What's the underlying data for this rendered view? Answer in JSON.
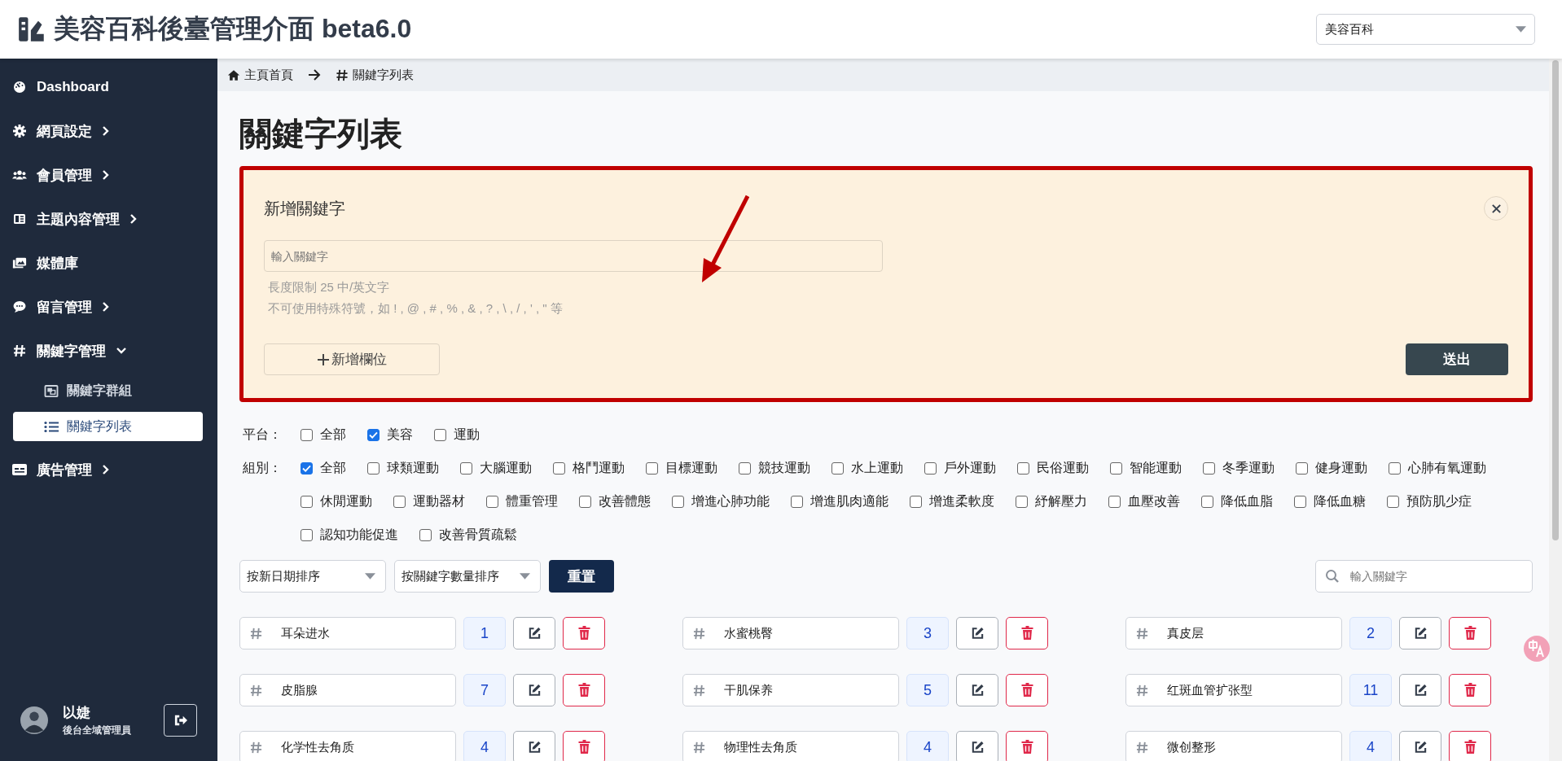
{
  "header": {
    "title": "美容百科後臺管理介面 beta6.0",
    "site_select": {
      "value": "美容百科"
    }
  },
  "sidebar": {
    "items": [
      {
        "label": "Dashboard",
        "kind": "link",
        "selected": false
      },
      {
        "label": "網頁設定",
        "kind": "group",
        "expanded": false,
        "selected": false
      },
      {
        "label": "會員管理",
        "kind": "group",
        "expanded": false,
        "selected": false
      },
      {
        "label": "主題內容管理",
        "kind": "group",
        "expanded": false,
        "selected": false
      },
      {
        "label": "媒體庫",
        "kind": "link",
        "selected": false
      },
      {
        "label": "留言管理",
        "kind": "group",
        "expanded": false,
        "selected": false
      },
      {
        "label": "關鍵字管理",
        "kind": "group",
        "expanded": true,
        "selected": false,
        "children": [
          {
            "label": "關鍵字群組",
            "selected": false
          },
          {
            "label": "關鍵字列表",
            "selected": true
          }
        ]
      },
      {
        "label": "廣告管理",
        "kind": "group",
        "expanded": false,
        "selected": false
      }
    ],
    "user": {
      "name": "以婕",
      "role": "後台全域管理員"
    }
  },
  "breadcrumb": [
    {
      "label": "主頁首頁"
    },
    {
      "label": "關鍵字列表"
    }
  ],
  "page_title": "關鍵字列表",
  "add_form": {
    "title": "新增關鍵字",
    "input": {
      "placeholder": "輸入關鍵字"
    },
    "hints": [
      "長度限制 25 中/英文字",
      "不可使用特殊符號，如 ! , @ , # , % , & , ? , \\ , / , ' , \" 等"
    ],
    "add_field_button": "新增欄位",
    "submit_button": "送出"
  },
  "filters": [
    {
      "label": "平台：",
      "options": [
        {
          "label": "全部",
          "checked": false
        },
        {
          "label": "美容",
          "checked": true
        },
        {
          "label": "運動",
          "checked": false
        }
      ]
    },
    {
      "label": "組別：",
      "options": [
        {
          "label": "全部",
          "checked": true
        },
        {
          "label": "球類運動",
          "checked": false
        },
        {
          "label": "大腦運動",
          "checked": false
        },
        {
          "label": "格鬥運動",
          "checked": false
        },
        {
          "label": "目標運動",
          "checked": false
        },
        {
          "label": "競技運動",
          "checked": false
        },
        {
          "label": "水上運動",
          "checked": false
        },
        {
          "label": "戶外運動",
          "checked": false
        },
        {
          "label": "民俗運動",
          "checked": false
        },
        {
          "label": "智能運動",
          "checked": false
        },
        {
          "label": "冬季運動",
          "checked": false
        },
        {
          "label": "健身運動",
          "checked": false
        },
        {
          "label": "心肺有氧運動",
          "checked": false
        },
        {
          "label": "休閒運動",
          "checked": false
        },
        {
          "label": "運動器材",
          "checked": false
        },
        {
          "label": "體重管理",
          "checked": false
        },
        {
          "label": "改善體態",
          "checked": false
        },
        {
          "label": "增進心肺功能",
          "checked": false
        },
        {
          "label": "增進肌肉適能",
          "checked": false
        },
        {
          "label": "增進柔軟度",
          "checked": false
        },
        {
          "label": "紓解壓力",
          "checked": false
        },
        {
          "label": "血壓改善",
          "checked": false
        },
        {
          "label": "降低血脂",
          "checked": false
        },
        {
          "label": "降低血糖",
          "checked": false
        },
        {
          "label": "預防肌少症",
          "checked": false
        },
        {
          "label": "認知功能促進",
          "checked": false
        },
        {
          "label": "改善骨質疏鬆",
          "checked": false
        }
      ]
    }
  ],
  "toolbar": {
    "sort_selects": [
      {
        "value": "按新日期排序"
      },
      {
        "value": "按關鍵字數量排序"
      }
    ],
    "reset_button": "重置",
    "search": {
      "placeholder": "輸入關鍵字"
    }
  },
  "keywords": [
    {
      "text": "耳朵进水",
      "count": "1"
    },
    {
      "text": "水蜜桃臀",
      "count": "3"
    },
    {
      "text": "真皮层",
      "count": "2"
    },
    {
      "text": "皮脂腺",
      "count": "7"
    },
    {
      "text": "干肌保养",
      "count": "5"
    },
    {
      "text": "红斑血管扩张型",
      "count": "11"
    },
    {
      "text": "化学性去角质",
      "count": "4"
    },
    {
      "text": "物理性去角质",
      "count": "4"
    },
    {
      "text": "微创整形",
      "count": "4"
    }
  ]
}
